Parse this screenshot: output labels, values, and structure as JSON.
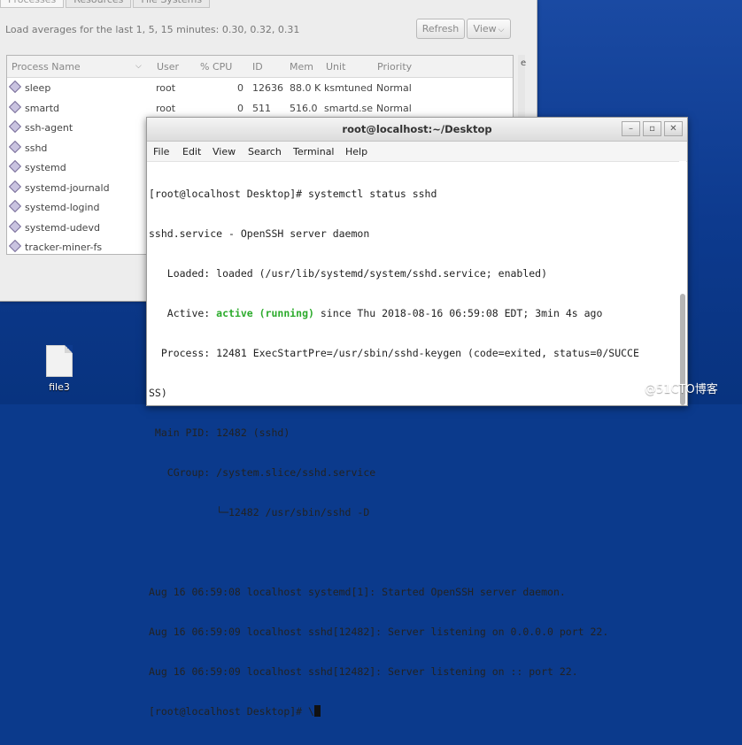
{
  "system_monitor": {
    "tabs": [
      "Processes",
      "Resources",
      "File Systems"
    ],
    "load_averages": "Load averages for the last 1, 5, 15 minutes: 0.30, 0.32, 0.31",
    "refresh_label": "Refresh",
    "view_label": "View",
    "columns": {
      "name": "Process Name",
      "user": "User",
      "cpu": "% CPU",
      "id": "ID",
      "mem": "Mem",
      "unit": "Unit",
      "priority": "Priority"
    },
    "rows": [
      {
        "name": "sleep",
        "user": "root",
        "cpu": "0",
        "id": "12636",
        "mem": "88.0 K",
        "unit": "ksmtuned",
        "priority": "Normal"
      },
      {
        "name": "smartd",
        "user": "root",
        "cpu": "0",
        "id": "511",
        "mem": "516.0",
        "unit": "smartd.se",
        "priority": "Normal"
      },
      {
        "name": "ssh-agent",
        "user": "",
        "cpu": "",
        "id": "",
        "mem": "",
        "unit": "",
        "priority": ""
      },
      {
        "name": "sshd",
        "user": "",
        "cpu": "",
        "id": "",
        "mem": "",
        "unit": "",
        "priority": ""
      },
      {
        "name": "systemd",
        "user": "",
        "cpu": "",
        "id": "",
        "mem": "",
        "unit": "",
        "priority": ""
      },
      {
        "name": "systemd-journald",
        "user": "",
        "cpu": "",
        "id": "",
        "mem": "",
        "unit": "",
        "priority": ""
      },
      {
        "name": "systemd-logind",
        "user": "",
        "cpu": "",
        "id": "",
        "mem": "",
        "unit": "",
        "priority": ""
      },
      {
        "name": "systemd-udevd",
        "user": "",
        "cpu": "",
        "id": "",
        "mem": "",
        "unit": "",
        "priority": ""
      },
      {
        "name": "tracker-miner-fs",
        "user": "",
        "cpu": "",
        "id": "",
        "mem": "",
        "unit": "",
        "priority": ""
      }
    ]
  },
  "terminal": {
    "title": "root@localhost:~/Desktop",
    "menu": [
      "File",
      "Edit",
      "View",
      "Search",
      "Terminal",
      "Help"
    ],
    "lines": [
      "[root@localhost Desktop]# systemctl status sshd",
      "sshd.service - OpenSSH server daemon",
      "   Loaded: loaded (/usr/lib/systemd/system/sshd.service; enabled)",
      "",
      "  Process: 12481 ExecStartPre=/usr/sbin/sshd-keygen (code=exited, status=0/SUCCE",
      "SS)",
      " Main PID: 12482 (sshd)",
      "   CGroup: /system.slice/sshd.service",
      "           └─12482 /usr/sbin/sshd -D",
      "",
      "Aug 16 06:59:08 localhost systemd[1]: Started OpenSSH server daemon.",
      "Aug 16 06:59:09 localhost sshd[12482]: Server listening on 0.0.0.0 port 22.",
      "Aug 16 06:59:09 localhost sshd[12482]: Server listening on :: port 22.",
      "[root@localhost Desktop]# \\"
    ],
    "active_line": {
      "prefix": "   Active: ",
      "status": "active (running)",
      "suffix": " since Thu 2018-08-16 06:59:08 EDT; 3min 4s ago"
    },
    "status_color": "#2cab2c"
  },
  "desktop": {
    "file_label": "file3",
    "watermark": "@51CTO博客"
  }
}
